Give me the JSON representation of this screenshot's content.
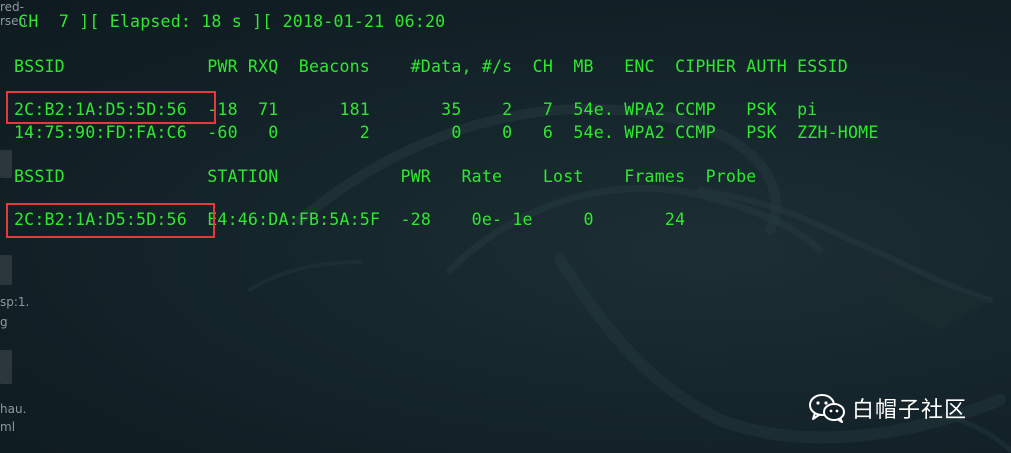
{
  "status_line": " CH  7 ][ Elapsed: 18 s ][ 2018-01-21 06:20",
  "ap_table": {
    "header": "BSSID              PWR RXQ  Beacons    #Data, #/s  CH  MB   ENC  CIPHER AUTH ESSID",
    "rows": [
      {
        "bssid": "2C:B2:1A:D5:5D:56",
        "rest": "  -18  71      181       35    2   7  54e. WPA2 CCMP   PSK  pi"
      },
      {
        "bssid": "14:75:90:FD:FA:C6",
        "rest": "  -60   0        2        0    0   6  54e. WPA2 CCMP   PSK  ZZH-HOME"
      }
    ]
  },
  "station_table": {
    "header": "BSSID              STATION            PWR   Rate    Lost    Frames  Probe",
    "rows": [
      {
        "bssid": "2C:B2:1A:D5:5D:56",
        "rest": "  E4:46:DA:FB:5A:5F  -28    0e- 1e     0       24"
      }
    ]
  },
  "desktop_strip": {
    "labels": [
      "red-",
      "rsen",
      "sp:1.",
      "g",
      "hau.",
      "ml"
    ]
  },
  "watermark": {
    "text": "白帽子社区",
    "icon": "wechat-icon"
  },
  "colors": {
    "terminal_text": "#2ee82e",
    "highlight_box": "#e23b3b",
    "background": "#0f1e24"
  }
}
